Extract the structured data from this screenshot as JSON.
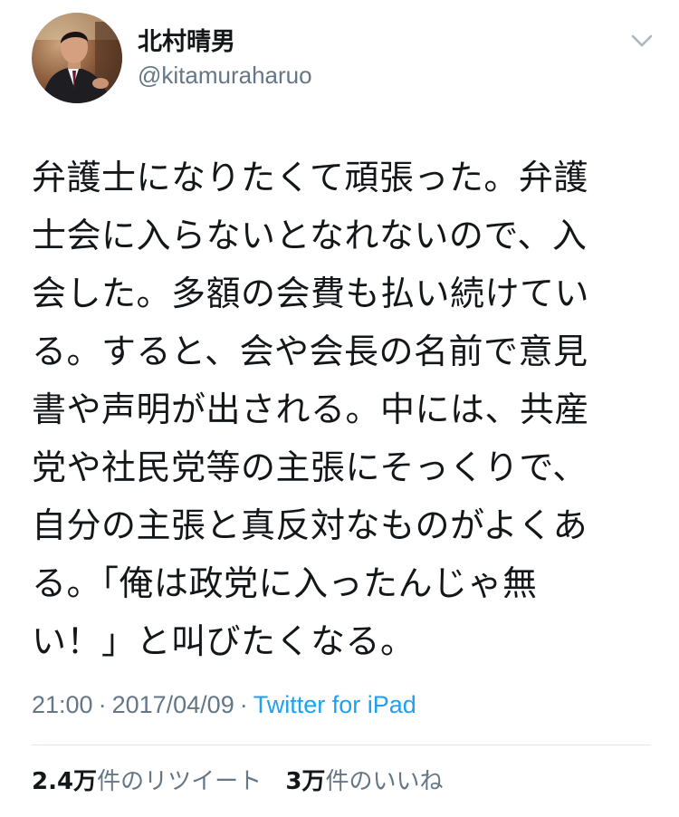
{
  "user": {
    "display_name": "北村晴男",
    "handle": "@kitamuraharuo"
  },
  "icons": {
    "avatar": "profile-photo",
    "menu": "chevron-down-icon"
  },
  "tweet": {
    "lines": [
      "弁護士になりたくて頑張った。弁護",
      "士会に入らないとなれないので、入",
      "会した。多額の会費も払い続けてい",
      "る。すると、会や会長の名前で意見",
      "書や声明が出される。中には、共産",
      "党や社民党等の主張にそっくりで、",
      "自分の主張と真反対なものがよくあ",
      "る。「俺は政党に入ったんじゃ無",
      "い！」と叫びたくなる。"
    ]
  },
  "meta": {
    "time": "21:00",
    "separator": "·",
    "date": "2017/04/09",
    "source": "Twitter for iPad"
  },
  "stats": {
    "retweets_count": "2.4万",
    "retweets_label": "件のリツイート",
    "likes_count": "3万",
    "likes_label": "件のいいね"
  },
  "colors": {
    "text": "#14171a",
    "secondary": "#657786",
    "link": "#1da1f2",
    "divider": "#e1e8ed"
  }
}
